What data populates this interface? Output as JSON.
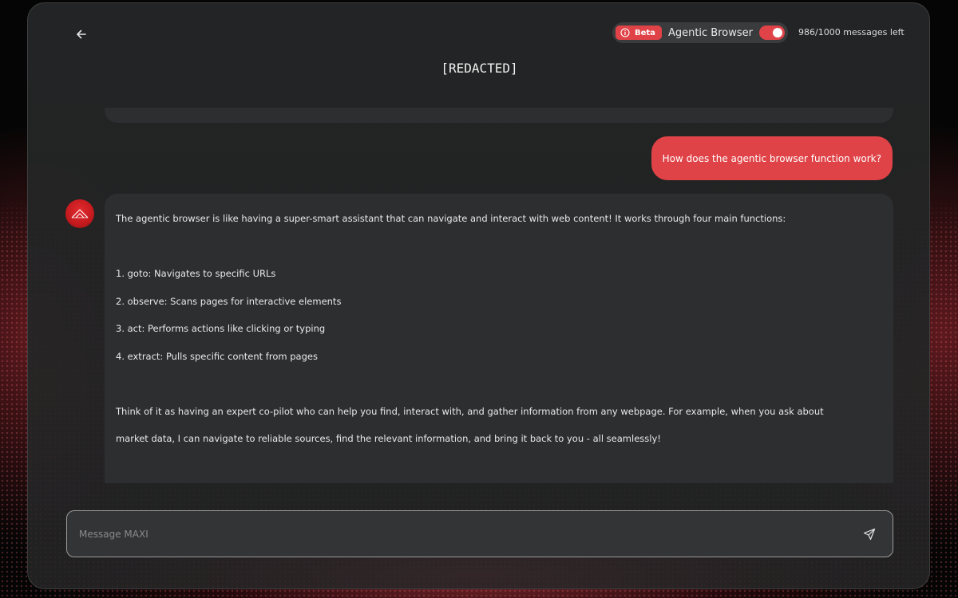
{
  "header": {
    "back_icon": "arrow-left-icon",
    "beta_badge": "Beta",
    "info_icon": "info-circle-icon",
    "agentic_browser_label": "Agentic Browser",
    "agentic_browser_enabled": true,
    "messages_left": "986/1000 messages left",
    "title": "[REDACTED]"
  },
  "conversation": {
    "user_message": "How does the agentic browser function work?",
    "assistant_avatar_icon": "maxi-logo-icon",
    "assistant_lines": [
      "The agentic browser is like having a super-smart assistant that can navigate and interact with web content! It works through four main functions:",
      "",
      "1. goto: Navigates to specific URLs",
      "2. observe: Scans pages for interactive elements",
      "3. act: Performs actions like clicking or typing",
      "4. extract: Pulls specific content from pages",
      "",
      "Think of it as having an expert co-pilot who can help you find, interact with, and gather information from any webpage. For example, when you ask about",
      "market data, I can navigate to reliable sources, find the relevant information, and bring it back to you - all seamlessly!"
    ]
  },
  "composer": {
    "placeholder": "Message MAXI",
    "value": "",
    "send_icon": "send-icon"
  },
  "colors": {
    "accent": "#e04347",
    "panel": "#242526",
    "bubble": "#2d2e30",
    "text": "#e9e9e9"
  }
}
